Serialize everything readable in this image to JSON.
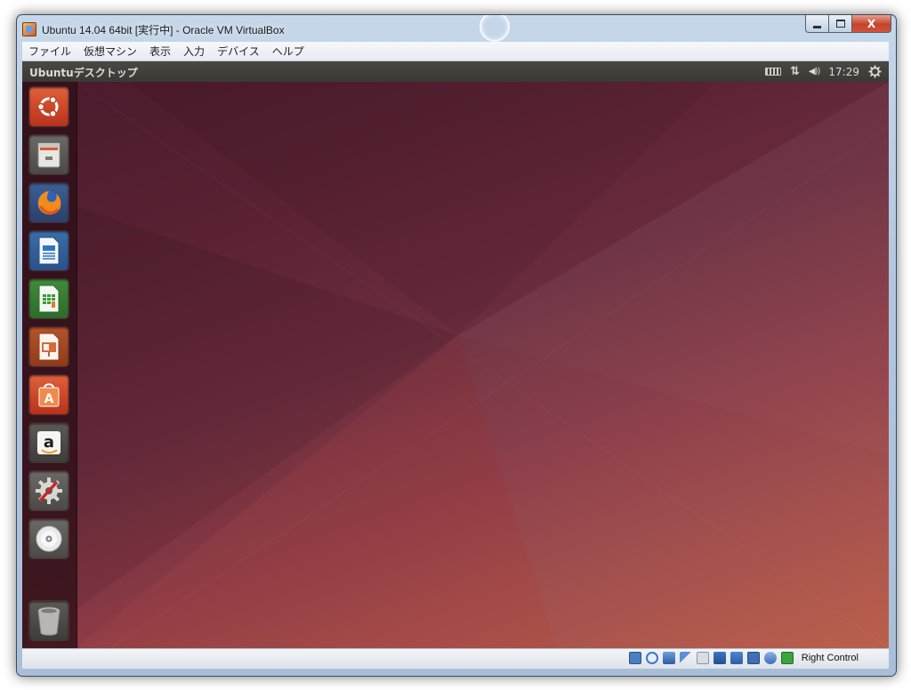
{
  "window": {
    "title": "Ubuntu 14.04 64bit [実行中] - Oracle VM VirtualBox",
    "close_label": "X"
  },
  "menu": [
    "ファイル",
    "仮想マシン",
    "表示",
    "入力",
    "デバイス",
    "ヘルプ"
  ],
  "ubuntu": {
    "panel_title": "Ubuntuデスクトップ",
    "clock": "17:29",
    "volume_glyph": "◀))",
    "network_glyph": "⇅"
  },
  "launcher": [
    {
      "name": "launcher-dash-button",
      "icon": "ubuntu-logo-icon"
    },
    {
      "name": "launcher-files-button",
      "icon": "file-cabinet-icon"
    },
    {
      "name": "launcher-firefox-button",
      "icon": "firefox-icon"
    },
    {
      "name": "launcher-writer-button",
      "icon": "libreoffice-writer-icon"
    },
    {
      "name": "launcher-calc-button",
      "icon": "libreoffice-calc-icon"
    },
    {
      "name": "launcher-impress-button",
      "icon": "libreoffice-impress-icon"
    },
    {
      "name": "launcher-software-center-button",
      "icon": "software-center-icon"
    },
    {
      "name": "launcher-amazon-button",
      "icon": "amazon-icon"
    },
    {
      "name": "launcher-system-settings-button",
      "icon": "settings-gear-icon"
    },
    {
      "name": "launcher-dvd-button",
      "icon": "disc-icon"
    },
    {
      "name": "launcher-trash-button",
      "icon": "trash-icon"
    }
  ],
  "statusbar": {
    "host_key": "Right Control"
  },
  "colors": {
    "ubuntu_orange": "#dd4814",
    "panel": "#3c3b37",
    "launcher_bg": "#2d0f16"
  }
}
